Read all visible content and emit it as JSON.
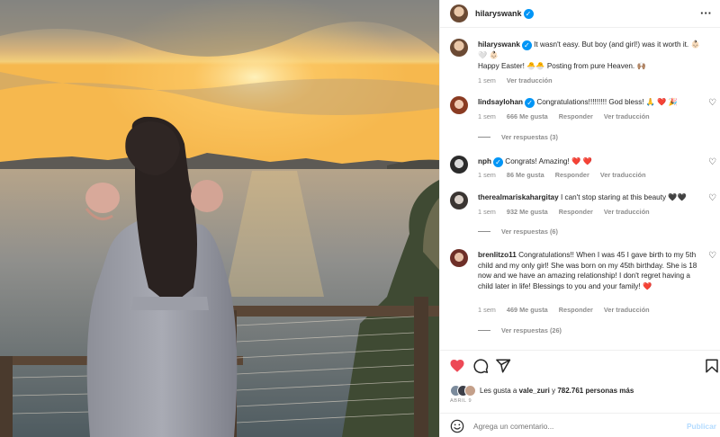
{
  "post": {
    "username": "hilaryswank",
    "caption_text": "It wasn't easy. But boy (and girl!) was it worth it. 👶🏻 🤍 👶🏻",
    "caption_line2": "Happy Easter! 🐣🐣 Posting from pure Heaven. 🙌🏽",
    "caption_time": "1 sem",
    "caption_translate": "Ver traducción"
  },
  "comments": [
    {
      "username": "lindsaylohan",
      "verified": true,
      "text": "Congratulations!!!!!!!!! God bless! 🙏 ❤️ 🎉",
      "time": "1 sem",
      "likes": "666 Me gusta",
      "reply": "Responder",
      "translate": "Ver traducción",
      "replies": "Ver respuestas (3)"
    },
    {
      "username": "nph",
      "verified": true,
      "text": "Congrats! Amazing! ❤️ ❤️",
      "time": "1 sem",
      "likes": "86 Me gusta",
      "reply": "Responder",
      "translate": "Ver traducción"
    },
    {
      "username": "therealmariskahargitay",
      "verified": false,
      "text": "I can't stop staring at this beauty 🖤🖤",
      "time": "1 sem",
      "likes": "932 Me gusta",
      "reply": "Responder",
      "translate": "Ver traducción",
      "replies": "Ver respuestas (6)"
    },
    {
      "username": "brenlitzo11",
      "verified": false,
      "text": "Congratulations!! When I was 45 I gave birth to my 5th child and my only girl! She was born on my 45th birthday. She is 18 now and we have an amazing relationship! I don't regret having a child later in life! Blessings to you and your family! ❤️",
      "time": "1 sem",
      "likes": "469 Me gusta",
      "reply": "Responder",
      "translate": "Ver traducción",
      "replies": "Ver respuestas (26)"
    }
  ],
  "actions": {
    "liked_by_prefix": "Les gusta a ",
    "liked_by_user": "vale_zuri",
    "liked_by_mid": " y ",
    "liked_by_count": "782.761 personas más",
    "date": "ABRIL 9"
  },
  "add_comment": {
    "placeholder": "Agrega un comentario...",
    "post_label": "Publicar"
  },
  "colors": {
    "like_red": "#ed4956",
    "verified_blue": "#0095f6",
    "secondary_text": "#8e8e8e"
  },
  "icons": [
    "more-options-icon",
    "heart-icon",
    "comment-icon",
    "share-icon",
    "bookmark-icon",
    "emoji-icon",
    "verified-icon"
  ]
}
